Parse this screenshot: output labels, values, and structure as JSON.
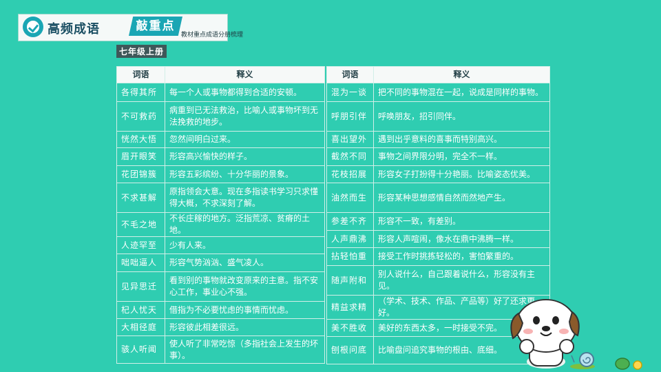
{
  "header": {
    "title": "高频成语",
    "tag": "敲重点",
    "subtitle": "教材重点成语分册梳理"
  },
  "grade": "七年级上册",
  "table": {
    "col_word": "词语",
    "col_meaning": "释义",
    "left_rows": [
      {
        "word": "各得其所",
        "meaning": "每一个人或事物都得到合适的安顿。"
      },
      {
        "word": "不可救药",
        "meaning": "病重到已无法救治，比喻人或事物坏到无法挽救的地步。"
      },
      {
        "word": "恍然大悟",
        "meaning": "忽然间明白过来。"
      },
      {
        "word": "眉开眼笑",
        "meaning": "形容高兴愉快的样子。"
      },
      {
        "word": "花团锦簇",
        "meaning": "形容五彩缤纷、十分华丽的景象。"
      },
      {
        "word": "不求甚解",
        "meaning": "原指领会大意。现在多指读书学习只求懂得大概，不求深刻了解。"
      },
      {
        "word": "不毛之地",
        "meaning": "不长庄稼的地方。泛指荒凉、贫瘠的土地。"
      },
      {
        "word": "人迹罕至",
        "meaning": "少有人来。"
      },
      {
        "word": "咄咄逼人",
        "meaning": "形容气势汹汹、盛气凌人。"
      },
      {
        "word": "见异思迁",
        "meaning": "看到别的事物就改变原来的主意。指不安心工作，事业心不强。"
      },
      {
        "word": "杞人忧天",
        "meaning": "借指为不必要忧虑的事情而忧虑。"
      },
      {
        "word": "大相径庭",
        "meaning": "形容彼此相差很远。"
      },
      {
        "word": "骇人听闻",
        "meaning": "使人听了非常吃惊（多指社会上发生的坏事）。"
      }
    ],
    "right_rows": [
      {
        "word": "混为一谈",
        "meaning": "把不同的事物混在一起，说成是同样的事物。"
      },
      {
        "word": "呼朋引伴",
        "meaning": "呼唤朋友，招引同伴。"
      },
      {
        "word": "喜出望外",
        "meaning": "遇到出乎意料的喜事而特别高兴。"
      },
      {
        "word": "截然不同",
        "meaning": "事物之间界限分明，完全不一样。"
      },
      {
        "word": "花枝招展",
        "meaning": "形容女子打扮得十分艳丽。比喻姿态优美。"
      },
      {
        "word": "油然而生",
        "meaning": "形容某种思想感情自然而然地产生。"
      },
      {
        "word": "参差不齐",
        "meaning": "形容不一致，有差别。"
      },
      {
        "word": "人声鼎沸",
        "meaning": "形容人声喧闹，像水在鼎中沸腾一样。"
      },
      {
        "word": "拈轻怕重",
        "meaning": "接受工作时挑拣轻松的，害怕繁重的。"
      },
      {
        "word": "随声附和",
        "meaning": "别人说什么，自己跟着说什么，形容没有主见。"
      },
      {
        "word": "精益求精",
        "meaning": "（学术、技术、作品、产品等）好了还求更好。"
      },
      {
        "word": "美不胜收",
        "meaning": "美好的东西太多，一时接受不完。"
      },
      {
        "word": "刨根问底",
        "meaning": "比喻盘问追究事物的根由、底细。"
      }
    ]
  }
}
